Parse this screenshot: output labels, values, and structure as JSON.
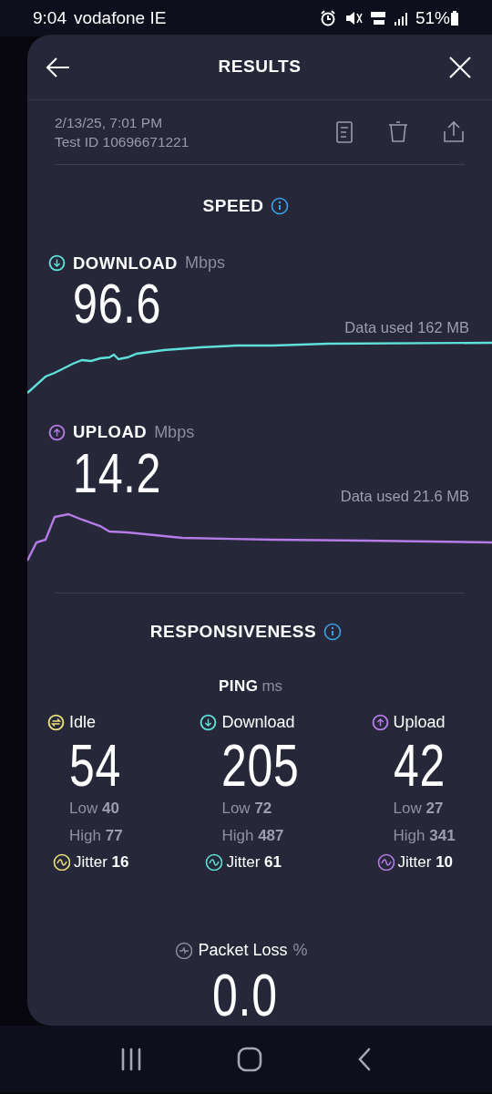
{
  "status_bar": {
    "time": "9:04",
    "carrier": "vodafone IE",
    "battery": "51%"
  },
  "header": {
    "title": "RESULTS"
  },
  "meta": {
    "date": "2/13/25, 7:01 PM",
    "test_id": "Test ID 10696671221"
  },
  "speed": {
    "title": "SPEED",
    "metrics": [
      {
        "kind": "download",
        "label": "DOWNLOAD",
        "unit": "Mbps",
        "value": "96.6",
        "data_used": "Data used 162 MB",
        "color": "#5fe0d8"
      },
      {
        "kind": "upload",
        "label": "UPLOAD",
        "unit": "Mbps",
        "value": "14.2",
        "data_used": "Data used 21.6 MB",
        "color": "#b57ce8"
      }
    ]
  },
  "responsiveness": {
    "title": "RESPONSIVENESS",
    "ping_label": "PING",
    "ping_unit": "ms",
    "columns": [
      {
        "kind": "idle",
        "label": "Idle",
        "value": "54",
        "low": "Low **40**",
        "high": "High **77**",
        "jitter": "Jitter **16**",
        "color": "#ece27a"
      },
      {
        "kind": "download",
        "label": "Download",
        "value": "205",
        "low": "Low **72**",
        "high": "High **487**",
        "jitter": "Jitter **61**",
        "color": "#5fe0d8"
      },
      {
        "kind": "upload",
        "label": "Upload",
        "value": "42",
        "low": "Low **27**",
        "high": "High **341**",
        "jitter": "Jitter **10**",
        "color": "#b57ce8"
      }
    ]
  },
  "packet_loss": {
    "label": "Packet Loss",
    "unit": "%",
    "value": "0.0"
  }
}
